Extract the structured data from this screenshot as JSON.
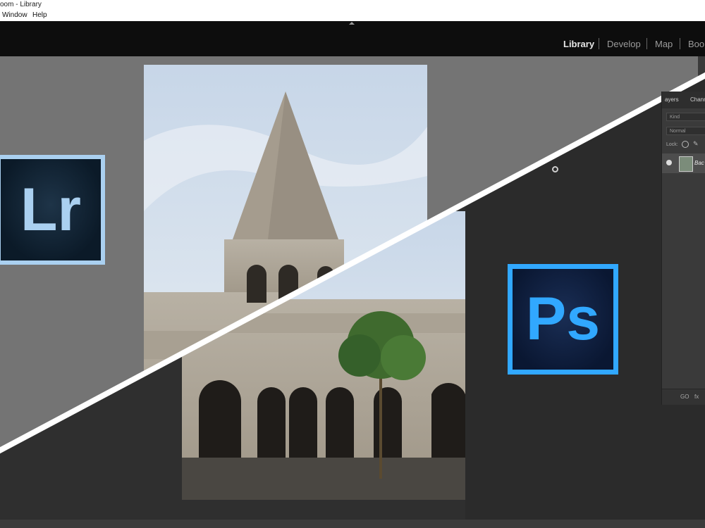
{
  "window": {
    "title": "oom - Library"
  },
  "menu": {
    "items": [
      "Window",
      "Help"
    ]
  },
  "modules": {
    "items": [
      "Library",
      "Develop",
      "Map",
      "Boo"
    ],
    "active_index": 0
  },
  "layers_panel": {
    "tabs": [
      "ayers",
      "Chann"
    ],
    "kind_placeholder": "Kind",
    "blend_mode": "Normal",
    "lock_label": "Lock:",
    "layer_name": "Bac",
    "footer_link": "GO",
    "footer_fx": "fx"
  },
  "logos": {
    "lightroom": "Lr",
    "photoshop": "Ps"
  },
  "colors": {
    "lightroom_accent": "#aad0f0",
    "photoshop_accent": "#31a8ff",
    "lr_background": "#747474",
    "ps_background": "#2b2b2b"
  }
}
